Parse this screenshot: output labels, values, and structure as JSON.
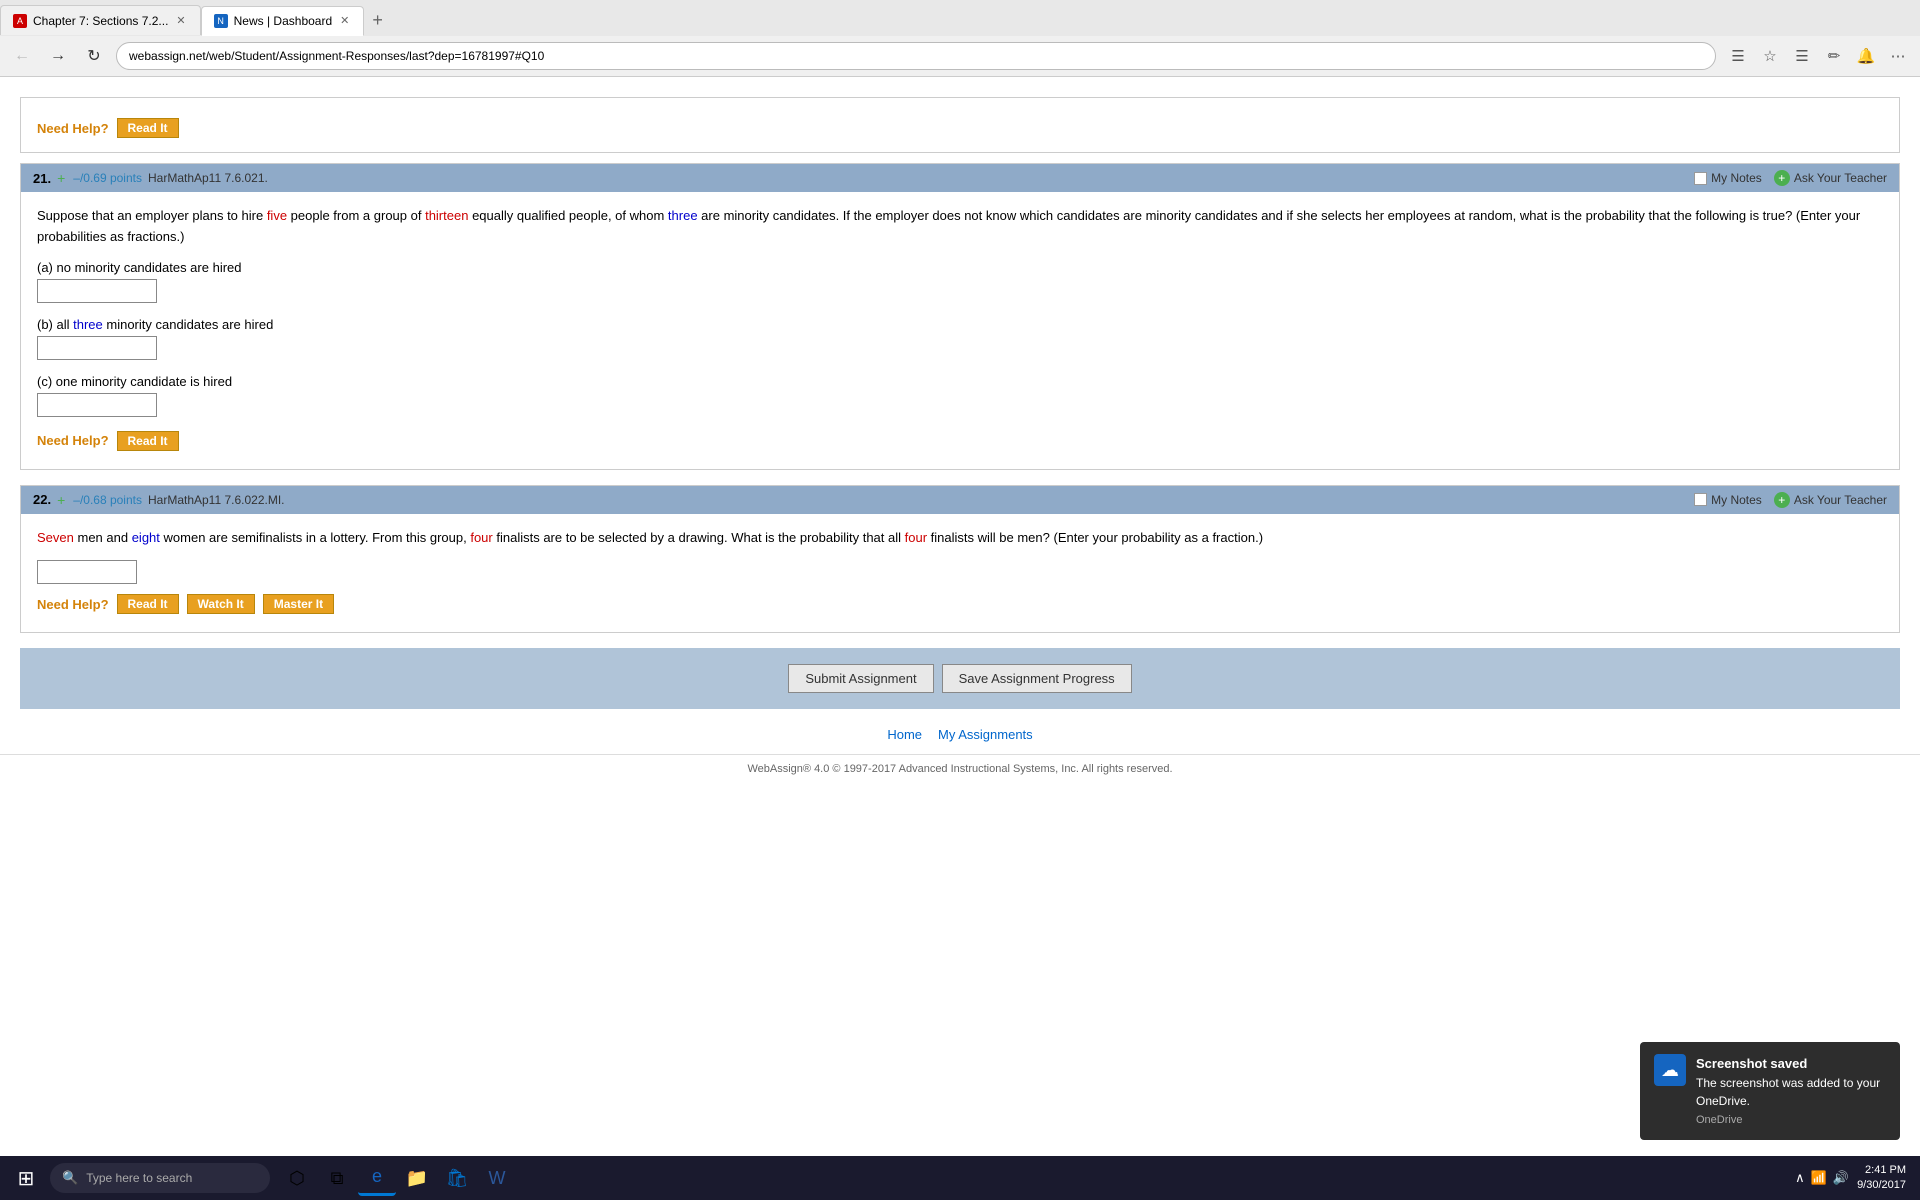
{
  "browser": {
    "tabs": [
      {
        "id": "tab1",
        "label": "Chapter 7: Sections 7.2...",
        "favicon_type": "red",
        "active": false
      },
      {
        "id": "tab2",
        "label": "News | Dashboard",
        "favicon_type": "blue",
        "active": true
      }
    ],
    "url": "webassign.net/web/Student/Assignment-Responses/last?dep=16781997#Q10",
    "new_tab": "+"
  },
  "top_block": {
    "need_help_label": "Need Help?",
    "read_it_label": "Read It"
  },
  "question21": {
    "number": "21.",
    "plus_symbol": "+",
    "points": "–/0.69 points",
    "question_id": "HarMathAp11 7.6.021.",
    "my_notes_label": "My Notes",
    "ask_teacher_label": "Ask Your Teacher",
    "text_part1": "Suppose that an employer plans to hire ",
    "five": "five",
    "text_part2": " people from a group of ",
    "thirteen": "thirteen",
    "text_part3": " equally qualified people, of whom ",
    "three": "three",
    "text_part4": " are minority candidates. If the employer does not know which candidates are minority candidates and if she selects her employees at random, what is the probability that the following is true? (Enter your probabilities as fractions.)",
    "sub_a_label": "(a) no minority candidates are hired",
    "sub_b_label": "(b) all ",
    "sub_b_three": "three",
    "sub_b_label2": " minority candidates are hired",
    "sub_c_label": "(c) one minority candidate is hired",
    "need_help_label": "Need Help?",
    "read_it_label": "Read It"
  },
  "question22": {
    "number": "22.",
    "plus_symbol": "+",
    "points": "–/0.68 points",
    "question_id": "HarMathAp11 7.6.022.MI.",
    "my_notes_label": "My Notes",
    "ask_teacher_label": "Ask Your Teacher",
    "seven": "Seven",
    "text_part1": " men and ",
    "eight": "eight",
    "text_part2": " women are semifinalists in a lottery. From this group, ",
    "four": "four",
    "text_part3": " finalists are to be selected by a drawing. What is the probability that all ",
    "four2": "four",
    "text_part4": " finalists will be men? (Enter your probability as a fraction.)",
    "need_help_label": "Need Help?",
    "read_it_label": "Read It",
    "watch_it_label": "Watch It",
    "master_it_label": "Master It"
  },
  "footer": {
    "submit_label": "Submit Assignment",
    "save_label": "Save Assignment Progress",
    "home_link": "Home",
    "my_assignments_link": "My Assignments",
    "copyright": "WebAssign® 4.0 © 1997-2017 Advanced Instructional Systems, Inc. All rights reserved."
  },
  "onedrive": {
    "title": "Screenshot saved",
    "message": "The screenshot was added to your OneDrive.",
    "source": "OneDrive"
  },
  "taskbar": {
    "search_placeholder": "Type here to search",
    "time": "2:41 PM",
    "date": "9/30/2017"
  }
}
